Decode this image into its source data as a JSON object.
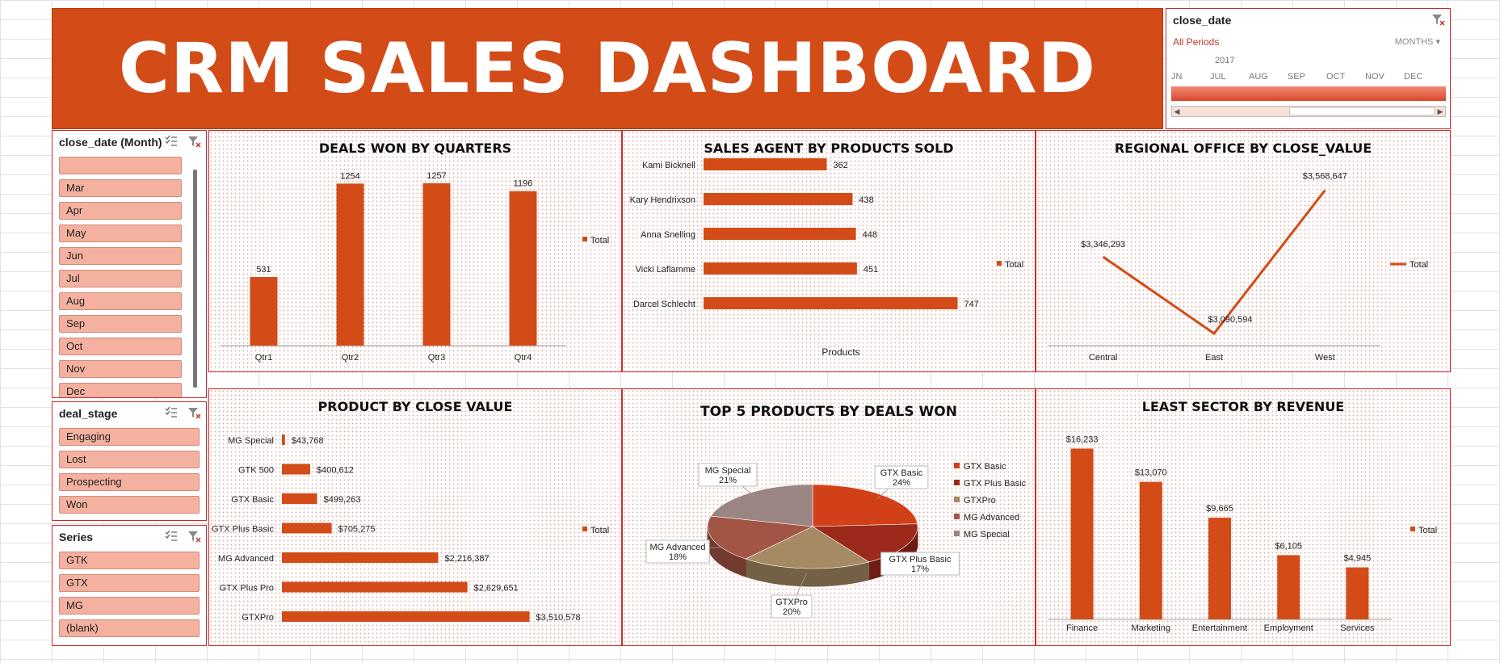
{
  "dashboard": {
    "title": "CRM SALES DASHBOARD"
  },
  "timeline": {
    "title": "close_date",
    "all_periods": "All Periods",
    "level": "MONTHS",
    "year": "2017",
    "months": [
      "JN",
      "JUL",
      "AUG",
      "SEP",
      "OCT",
      "NOV",
      "DEC"
    ],
    "colors": {
      "bar": "#e25c3c",
      "accent": "#c0392b"
    }
  },
  "slicer_month": {
    "title": "close_date (Month)",
    "items": [
      "",
      "Mar",
      "Apr",
      "May",
      "Jun",
      "Jul",
      "Aug",
      "Sep",
      "Oct",
      "Nov",
      "Dec"
    ]
  },
  "slicer_stage": {
    "title": "deal_stage",
    "items": [
      "Engaging",
      "Lost",
      "Prospecting",
      "Won"
    ]
  },
  "slicer_series": {
    "title": "Series",
    "items": [
      "GTK",
      "GTX",
      "MG",
      "(blank)"
    ]
  },
  "charts": {
    "deals_won": {
      "title": "DEALS WON BY QUARTERS",
      "legend": "Total"
    },
    "agents": {
      "title": "SALES AGENT BY PRODUCTS SOLD",
      "legend": "Total",
      "xlabel": "Products"
    },
    "regional": {
      "title": "REGIONAL OFFICE BY CLOSE_VALUE",
      "legend": "Total"
    },
    "products": {
      "title": "PRODUCT BY CLOSE VALUE",
      "legend": "Total"
    },
    "top5": {
      "title": "TOP  5 PRODUCTS  BY DEALS  WON"
    },
    "sector": {
      "title": "LEAST SECTOR BY REVENUE",
      "legend": "Total"
    }
  },
  "chart_data": [
    {
      "id": "deals_won",
      "type": "bar",
      "title": "DEALS WON BY QUARTERS",
      "categories": [
        "Qtr1",
        "Qtr2",
        "Qtr3",
        "Qtr4"
      ],
      "values": [
        531,
        1254,
        1257,
        1196
      ],
      "labels": [
        "531",
        "1254",
        "1257",
        "1196"
      ],
      "ylim": [
        0,
        1300
      ],
      "legend": "Total",
      "color": "#d34b17"
    },
    {
      "id": "agents",
      "type": "bar",
      "orientation": "horizontal",
      "title": "SALES AGENT BY PRODUCTS SOLD",
      "categories": [
        "Kami Bicknell",
        "Kary Hendrixson",
        "Anna Snelling",
        "Vicki Laflamme",
        "Darcel Schlecht"
      ],
      "values": [
        362,
        438,
        448,
        451,
        747
      ],
      "labels": [
        "362",
        "438",
        "448",
        "451",
        "747"
      ],
      "xlabel": "Products",
      "xlim": [
        0,
        760
      ],
      "legend": "Total",
      "color": "#d34b17"
    },
    {
      "id": "regional",
      "type": "line",
      "title": "REGIONAL OFFICE BY CLOSE_VALUE",
      "categories": [
        "Central",
        "East",
        "West"
      ],
      "values": [
        3346293,
        3090594,
        3568647
      ],
      "labels": [
        "$3,346,293",
        "$3,090,594",
        "$3,568,647"
      ],
      "ylim": [
        3050000,
        3600000
      ],
      "legend": "Total",
      "color": "#d34b17"
    },
    {
      "id": "products",
      "type": "bar",
      "orientation": "horizontal",
      "title": "PRODUCT BY CLOSE VALUE",
      "categories": [
        "MG Special",
        "GTK 500",
        "GTX Basic",
        "GTX Plus Basic",
        "MG Advanced",
        "GTX Plus Pro",
        "GTXPro"
      ],
      "values": [
        43768,
        400612,
        499263,
        705275,
        2216387,
        2629651,
        3510578
      ],
      "labels": [
        "$43,768",
        "$400,612",
        "$499,263",
        "$705,275",
        "$2,216,387",
        "$2,629,651",
        "$3,510,578"
      ],
      "xlim": [
        0,
        3550000
      ],
      "legend": "Total",
      "color": "#d34b17"
    },
    {
      "id": "top5",
      "type": "pie",
      "title": "TOP  5 PRODUCTS  BY DEALS  WON",
      "categories": [
        "GTX Basic",
        "GTX Plus Basic",
        "GTXPro",
        "MG Advanced",
        "MG Special"
      ],
      "values": [
        24,
        17,
        20,
        18,
        21
      ],
      "labels": [
        "GTX Basic\n24%",
        "GTX Plus Basic\n17%",
        "GTXPro\n20%",
        "MG Advanced\n18%",
        "MG Special\n21%"
      ],
      "colors": [
        "#d2401a",
        "#9b2a1c",
        "#a68a63",
        "#a35545",
        "#9a8582"
      ]
    },
    {
      "id": "sector",
      "type": "bar",
      "title": "LEAST SECTOR BY REVENUE",
      "categories": [
        "Finance",
        "Marketing",
        "Entertainment",
        "Employment",
        "Services"
      ],
      "values": [
        16233,
        13070,
        9665,
        6105,
        4945
      ],
      "labels": [
        "$16,233",
        "$13,070",
        "$9,665",
        "$6,105",
        "$4,945"
      ],
      "ylim": [
        0,
        16500
      ],
      "legend": "Total",
      "color": "#d34b17"
    }
  ]
}
